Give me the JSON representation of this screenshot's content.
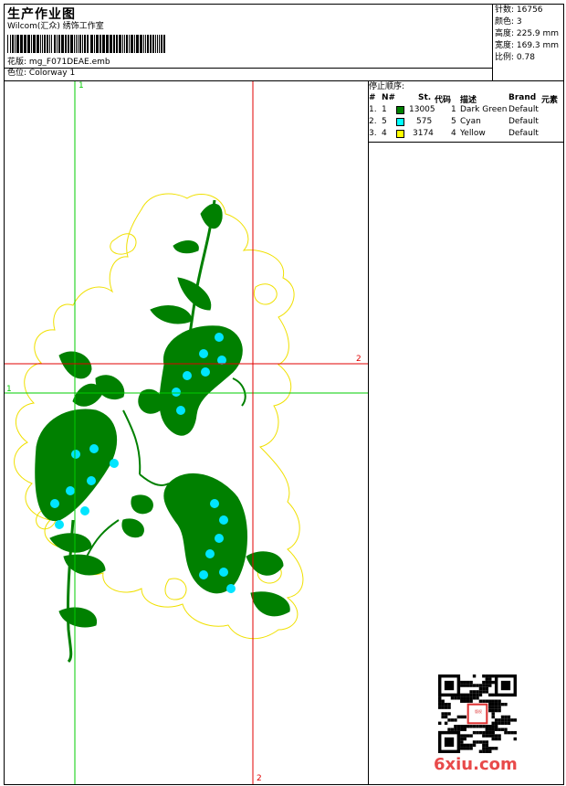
{
  "header": {
    "title": "生产作业图",
    "company": "Wilcom(汇众) 绣饰工作室",
    "design_label": "花版:",
    "design_file": "mg_F071DEAE.emb",
    "colorway_label": "色位:",
    "colorway": "Colorway 1"
  },
  "stats": {
    "stitches": "针数: 16756",
    "colors": "颜色: 3",
    "height": "高度: 225.9 mm",
    "width": "宽度: 169.3 mm",
    "scale": "比例: 0.78"
  },
  "stop_sequence": {
    "title": "停止顺序:",
    "columns": [
      "#",
      "N#",
      "St.",
      "代码",
      "描述",
      "Brand",
      "元素"
    ],
    "rows": [
      {
        "idx": "1.",
        "needle": "1",
        "color": "#008000",
        "stitches": "13005",
        "code": "1",
        "desc": "Dark Green",
        "brand": "Default"
      },
      {
        "idx": "2.",
        "needle": "5",
        "color": "#00ffff",
        "stitches": "575",
        "code": "5",
        "desc": "Cyan",
        "brand": "Default"
      },
      {
        "idx": "3.",
        "needle": "4",
        "color": "#ffff00",
        "stitches": "3174",
        "code": "4",
        "desc": "Yellow",
        "brand": "Default"
      }
    ]
  },
  "guides": {
    "green_label_top": "1",
    "green_label_left": "1",
    "red_label_right": "2",
    "red_label_bottom": "2"
  },
  "colors": {
    "green_thread": "#008000",
    "cyan_thread": "#00e5ff",
    "yellow_thread": "#f0e000",
    "guide_green": "#00cc00",
    "guide_red": "#e00000"
  },
  "watermark": {
    "site": "6xiu.com",
    "stamp": "版权"
  }
}
